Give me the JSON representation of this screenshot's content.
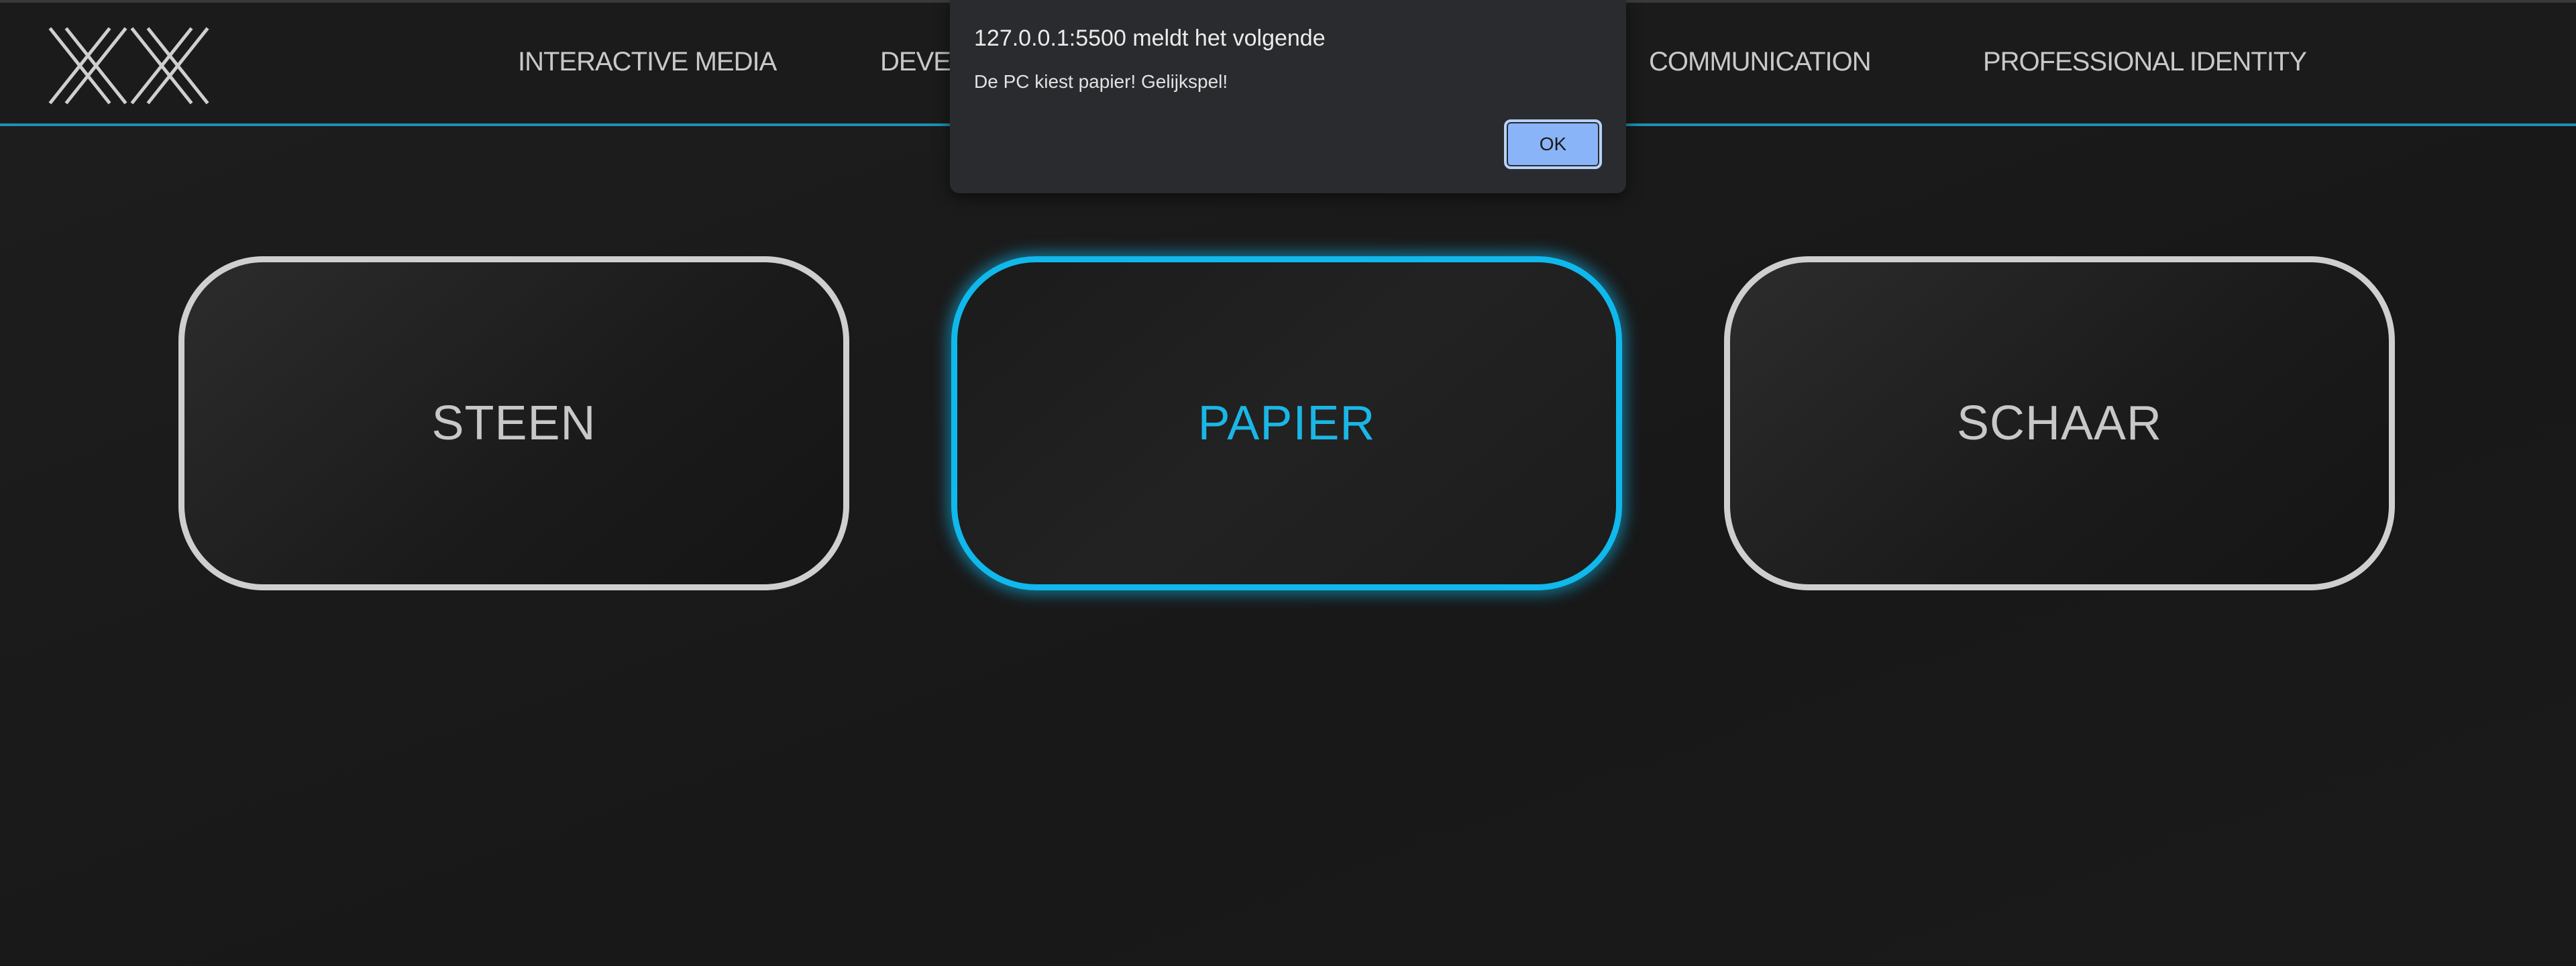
{
  "nav": {
    "logo": "XX",
    "items": [
      {
        "label": "INTERACTIVE MEDIA"
      },
      {
        "label": "DEVEL"
      },
      {
        "label": "COMMUNICATION"
      },
      {
        "label": "PROFESSIONAL IDENTITY"
      }
    ],
    "accent_color": "#1e8fb8"
  },
  "game": {
    "choices": [
      {
        "label": "STEEN",
        "selected": false
      },
      {
        "label": "PAPIER",
        "selected": true
      },
      {
        "label": "SCHAAR",
        "selected": false
      }
    ],
    "selected_color": "#10b8ec"
  },
  "dialog": {
    "title": "127.0.0.1:5500 meldt het volgende",
    "message": "De PC kiest papier! Gelijkspel!",
    "ok_label": "OK"
  }
}
